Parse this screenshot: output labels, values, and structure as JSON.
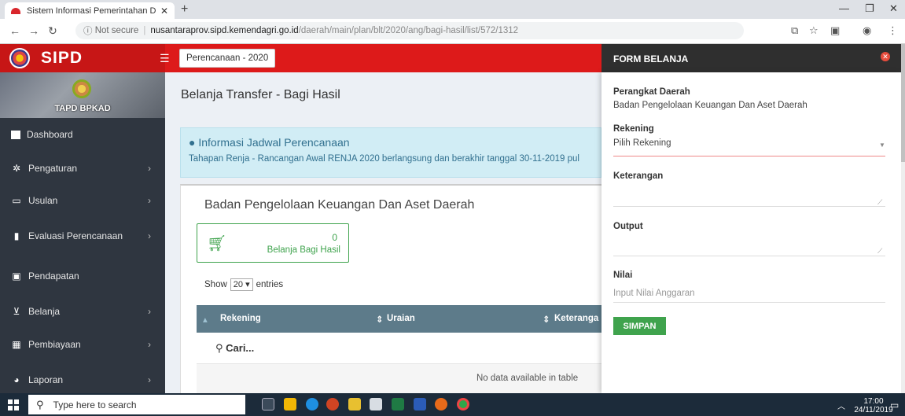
{
  "browser": {
    "tab_title": "Sistem Informasi Pemerintahan D",
    "security": "Not secure",
    "host": "nusantaraprov.sipd.kemendagri.go.id",
    "path": "/daerah/main/plan/blt/2020/ang/bagi-hasil/list/572/1312"
  },
  "app": {
    "logo_text": "SIPD",
    "year_button": "Perencanaan - 2020",
    "profile_name": "TAPD BPKAD"
  },
  "sidebar": {
    "items": [
      {
        "label": "Dashboard",
        "icon": "dashboard-icon"
      },
      {
        "label": "Pengaturan",
        "icon": "gear-icon"
      },
      {
        "label": "Usulan",
        "icon": "comment-icon"
      },
      {
        "label": "Evaluasi Perencanaan",
        "icon": "bookmark-icon"
      },
      {
        "label": "Pendapatan",
        "icon": "card-icon"
      },
      {
        "label": "Belanja",
        "icon": "cart-icon"
      },
      {
        "label": "Pembiayaan",
        "icon": "calculator-icon"
      },
      {
        "label": "Laporan",
        "icon": "pie-chart-icon"
      }
    ]
  },
  "main": {
    "page_title": "Belanja Transfer - Bagi Hasil",
    "alert_title": "Informasi Jadwal Perencanaan",
    "alert_text": "Tahapan Renja - Rancangan Awal RENJA 2020 berlangsung dan berakhir tanggal 30-11-2019 pul",
    "panel_title": "Badan Pengelolaan Keuangan Dan Aset Daerah",
    "stat_count": "0",
    "stat_label": "Belanja Bagi Hasil",
    "show_prefix": "Show",
    "show_value": "20",
    "show_suffix": "entries",
    "columns": [
      "Rekening",
      "Uraian",
      "Keteranga"
    ],
    "search_placeholder": "Cari...",
    "no_data": "No data available in table"
  },
  "form": {
    "title": "FORM BELANJA",
    "perangkat_label": "Perangkat Daerah",
    "perangkat_value": "Badan Pengelolaan Keuangan Dan Aset Daerah",
    "rekening_label": "Rekening",
    "rekening_value": "Pilih Rekening",
    "keterangan_label": "Keterangan",
    "output_label": "Output",
    "nilai_label": "Nilai",
    "nilai_placeholder": "Input Nilai Anggaran",
    "save_label": "SIMPAN"
  },
  "taskbar": {
    "search_placeholder": "Type here to search",
    "time": "17:00",
    "date": "24/11/2019"
  },
  "colors": {
    "header_red": "#dd1a1a",
    "sidebar_dark": "#2f3640",
    "accent_green": "#3fa34d",
    "table_header": "#5d7b8a"
  }
}
